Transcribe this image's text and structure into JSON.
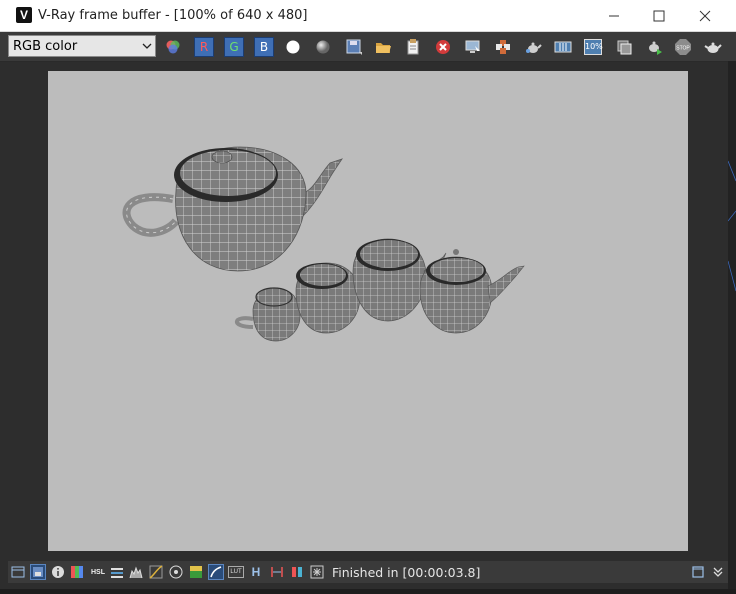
{
  "window": {
    "title": "V-Ray frame buffer - [100% of 640 x 480]",
    "app_icon_glyph": "V"
  },
  "toolbar": {
    "channel_select": {
      "value": "RGB color"
    },
    "red_channel_label": "R",
    "green_channel_label": "G",
    "blue_channel_label": "B",
    "zoom_badge": "10%",
    "stop_label": "STOP"
  },
  "statusbar": {
    "hsl_label": "HSL",
    "lut_label": "LUT",
    "h_label": "H",
    "status_text": "Finished in [00:00:03.8]"
  },
  "colors": {
    "channel_button": "#3f6fb5",
    "viewport_bg": "#bcbcbc",
    "toolbar_bg": "#3a3a3a"
  }
}
